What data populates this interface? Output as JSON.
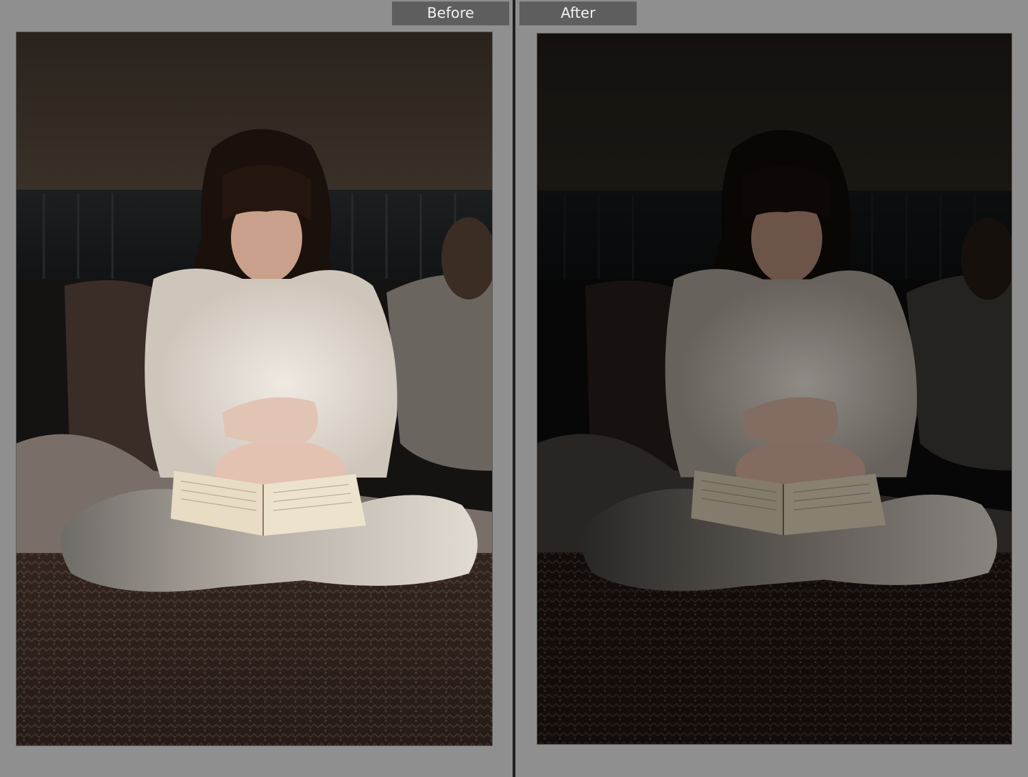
{
  "compare": {
    "before_label": "Before",
    "after_label": "After"
  },
  "colors": {
    "background": "#8f8f8f",
    "divider": "#1e1e1e",
    "label_tab": "#5e5e5e",
    "label_text": "#f2f2f2"
  }
}
